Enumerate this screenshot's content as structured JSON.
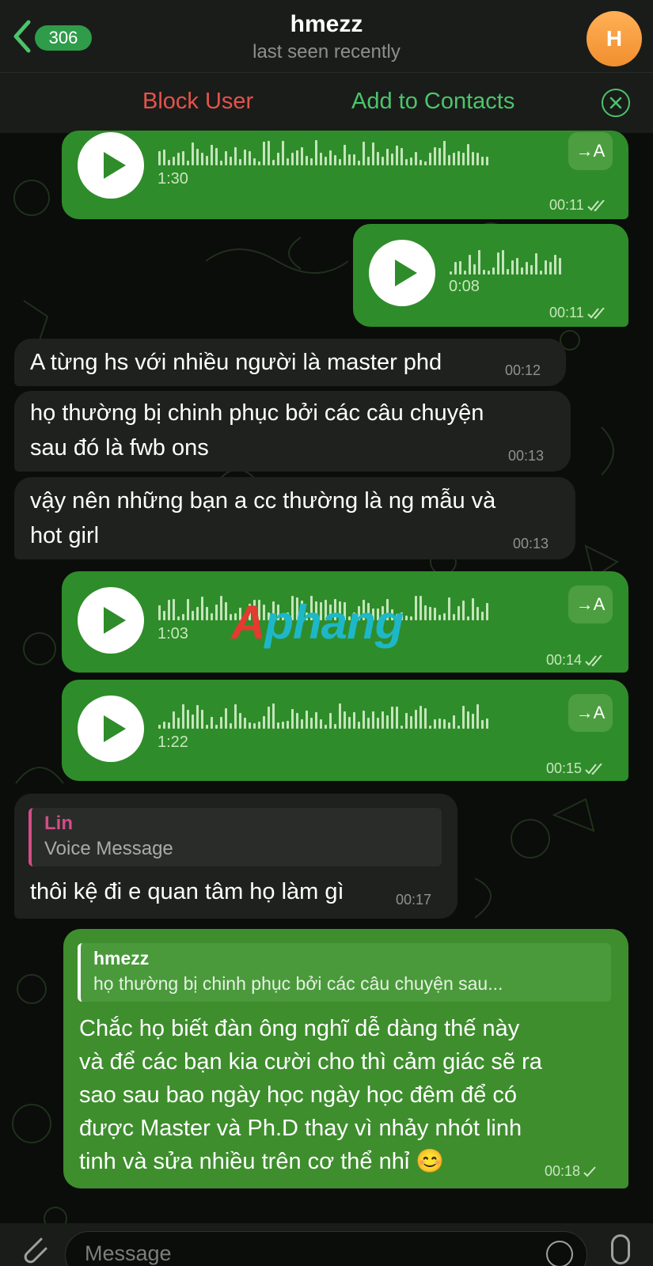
{
  "header": {
    "back_count": "306",
    "title": "hmezz",
    "subtitle": "last seen recently",
    "avatar_letter": "H"
  },
  "actions": {
    "block_label": "Block User",
    "add_label": "Add to Contacts"
  },
  "messages": [
    {
      "type": "voice",
      "dir": "out",
      "duration": "1:30",
      "time": "00:11",
      "transcribe": "→A"
    },
    {
      "type": "voice",
      "dir": "out",
      "duration": "0:08",
      "time": "00:11"
    },
    {
      "type": "text",
      "dir": "in",
      "text": "A từng hs với nhiều người là master phd",
      "time": "00:12"
    },
    {
      "type": "text",
      "dir": "in",
      "lines": [
        "họ thường bị chinh phục bởi các câu chuyện",
        "sau đó là fwb ons"
      ],
      "time": "00:13"
    },
    {
      "type": "text",
      "dir": "in",
      "lines": [
        "vậy nên những bạn a cc thường là ng mẫu và",
        "hot girl"
      ],
      "time": "00:13"
    },
    {
      "type": "voice",
      "dir": "out",
      "duration": "1:03",
      "time": "00:14",
      "transcribe": "→A"
    },
    {
      "type": "voice",
      "dir": "out",
      "duration": "1:22",
      "time": "00:15",
      "transcribe": "→A"
    },
    {
      "type": "reply",
      "dir": "in",
      "reply_name": "Lin",
      "reply_text": "Voice Message",
      "text": "thôi kệ đi e quan tâm họ làm gì",
      "time": "00:17"
    },
    {
      "type": "reply",
      "dir": "out",
      "reply_name": "hmezz",
      "reply_text": "họ thường bị chinh phục bởi các câu chuyện sau...",
      "lines": [
        "Chắc họ biết đàn ông nghĩ dễ dàng thế này",
        "và để các bạn kia cười cho thì cảm giác sẽ ra",
        "sao sau bao ngày học ngày học đêm để có",
        "được Master và Ph.D thay vì nhảy nhót linh",
        "tinh và sửa nhiều trên cơ thể nhỉ 😊"
      ],
      "time": "00:18"
    }
  ],
  "watermark": {
    "part1": "A",
    "part2": "phang"
  },
  "composer": {
    "placeholder": "Message"
  },
  "colors": {
    "accent_green": "#4cc46a",
    "block_red": "#e5534b",
    "outgoing_bubble": "#2f8c2a",
    "incoming_bubble": "#1f211f",
    "reply_accent": "#d34d86"
  }
}
